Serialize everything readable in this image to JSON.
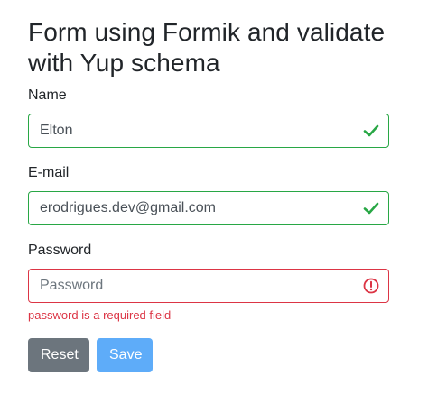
{
  "form": {
    "title": "Form using Formik and validate with Yup schema",
    "fields": {
      "name": {
        "label": "Name",
        "value": "Elton",
        "status": "valid",
        "icon": "check-icon"
      },
      "email": {
        "label": "E-mail",
        "value": "erodrigues.dev@gmail.com",
        "status": "valid",
        "icon": "check-icon"
      },
      "password": {
        "label": "Password",
        "value": "",
        "placeholder": "Password",
        "status": "invalid",
        "icon": "error-circle-icon",
        "error": "password is a required field"
      }
    },
    "buttons": {
      "reset_label": "Reset",
      "save_label": "Save"
    }
  },
  "colors": {
    "valid": "#28a745",
    "invalid": "#dc3545",
    "reset_button": "#6c757d",
    "save_button": "#5eacf9"
  }
}
